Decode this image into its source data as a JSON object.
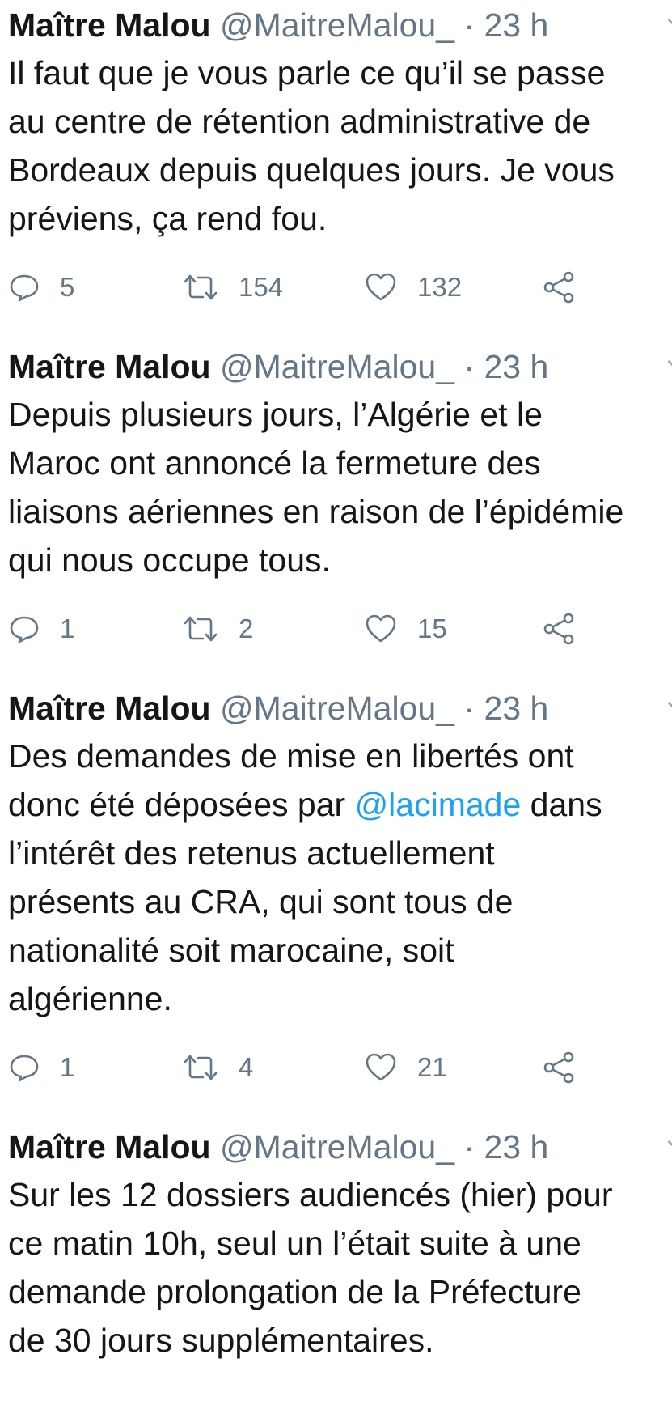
{
  "tweets": [
    {
      "author": "Maître Malou",
      "handle": "@MaitreMalou_",
      "separator": "·",
      "time": "23 h",
      "lines": [
        "Il faut que je vous parle ce qu’il se passe",
        "au centre de rétention administrative de",
        "Bordeaux depuis quelques jours. Je vous",
        "préviens, ça rend fou."
      ],
      "replies": "5",
      "retweets": "154",
      "likes": "132"
    },
    {
      "author": "Maître Malou",
      "handle": "@MaitreMalou_",
      "separator": "·",
      "time": "23 h",
      "lines": [
        "Depuis plusieurs jours, l’Algérie et le",
        "Maroc ont annoncé la fermeture des",
        "liaisons aériennes en raison de l’épidémie",
        "qui nous occupe tous."
      ],
      "replies": "1",
      "retweets": "2",
      "likes": "15"
    },
    {
      "author": "Maître Malou",
      "handle": "@MaitreMalou_",
      "separator": "·",
      "time": "23 h",
      "lines": [
        "Des demandes de mise en libertés ont",
        "donc été déposées par",
        "l’intérêt des retenus actuellement",
        "présents au CRA, qui sont tous de",
        "nationalité soit marocaine, soit",
        "algérienne."
      ],
      "mention": "@lacimade",
      "mention_after": "dans",
      "replies": "1",
      "retweets": "4",
      "likes": "21"
    },
    {
      "author": "Maître Malou",
      "handle": "@MaitreMalou_",
      "separator": "·",
      "time": "23 h",
      "lines": [
        "Sur les 12 dossiers audiencés (hier) pour",
        "ce matin 10h, seul un l’était suite à une",
        "demande prolongation de la Préfecture",
        "de 30 jours supplémentaires."
      ]
    }
  ],
  "icons": {
    "reply": "reply-icon",
    "retweet": "retweet-icon",
    "like": "heart-icon",
    "share": "share-icon",
    "caret": "chevron-down-icon"
  },
  "colors": {
    "text": "#14171a",
    "secondary": "#657786",
    "link": "#1da1f2"
  }
}
